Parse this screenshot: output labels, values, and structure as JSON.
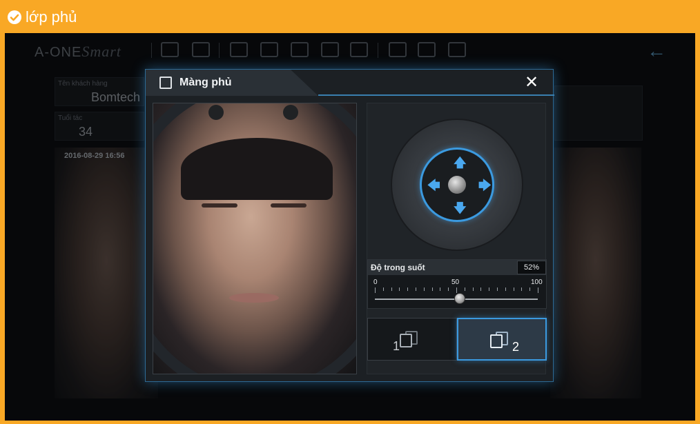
{
  "header": {
    "title": "lớp phủ",
    "icon": "check-circle-icon",
    "background": "#f9a825"
  },
  "background_app": {
    "brand": {
      "main": "A-ONE",
      "script": "Smart"
    },
    "toolbar_icons": [
      "camera-icon",
      "clipboard-search-icon",
      "portrait-icon",
      "3d-box-icon",
      "head-profile-icon",
      "chart-icon",
      "video-play-icon",
      "printer-icon",
      "save-icon",
      "folder-open-icon"
    ],
    "back_icon": "arrow-left-icon",
    "customer_name_label": "Tên khách hàng",
    "customer_name": "Bomtech",
    "age_label": "Tuổi tác",
    "age": "34",
    "photo_date": "2016-08-29 16:56"
  },
  "modal": {
    "title": "Màng phủ",
    "title_icon": "portrait-icon",
    "close_icon": "close-icon",
    "close_glyph": "✕",
    "joystick": {
      "up": "🡅",
      "down": "🡇",
      "left": "🡄",
      "right": "🡆"
    },
    "opacity": {
      "label": "Độ trong suốt",
      "value_text": "52%",
      "value": 52,
      "scale_min": "0",
      "scale_mid": "50",
      "scale_max": "100"
    },
    "modes": [
      {
        "label": "1",
        "active": false
      },
      {
        "label": "2",
        "active": true
      }
    ],
    "accent": "#3b9ae0"
  }
}
